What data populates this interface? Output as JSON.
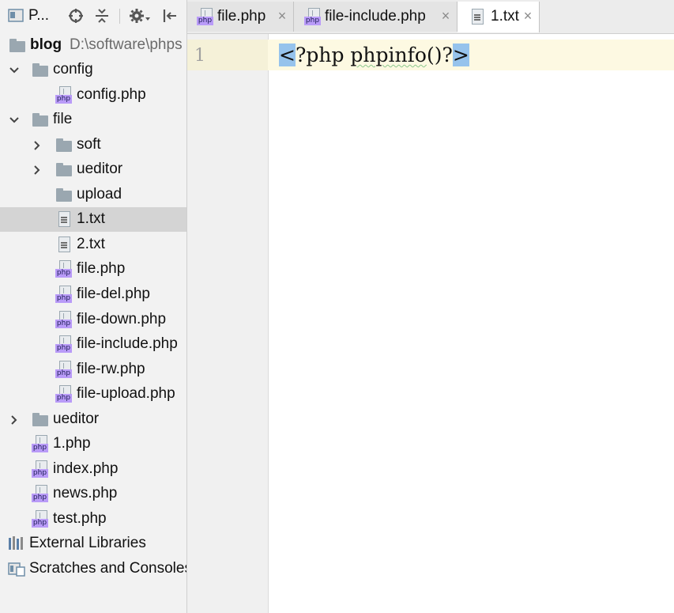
{
  "toolbar": {
    "project_view_label": "P...",
    "icons": [
      "project-view-icon",
      "locate-icon",
      "collapse-all-icon",
      "gear-icon",
      "hide-icon"
    ]
  },
  "tree": {
    "root": {
      "name": "blog",
      "path": "D:\\software\\phps"
    },
    "items": [
      {
        "label": "config",
        "type": "folder"
      },
      {
        "label": "config.php",
        "type": "php"
      },
      {
        "label": "file",
        "type": "folder"
      },
      {
        "label": "soft",
        "type": "folder"
      },
      {
        "label": "ueditor",
        "type": "folder"
      },
      {
        "label": "upload",
        "type": "folder"
      },
      {
        "label": "1.txt",
        "type": "txt"
      },
      {
        "label": "2.txt",
        "type": "txt"
      },
      {
        "label": "file.php",
        "type": "php"
      },
      {
        "label": "file-del.php",
        "type": "php"
      },
      {
        "label": "file-down.php",
        "type": "php"
      },
      {
        "label": "file-include.php",
        "type": "php"
      },
      {
        "label": "file-rw.php",
        "type": "php"
      },
      {
        "label": "file-upload.php",
        "type": "php"
      },
      {
        "label": "ueditor",
        "type": "folder"
      },
      {
        "label": "1.php",
        "type": "php"
      },
      {
        "label": "index.php",
        "type": "php"
      },
      {
        "label": "news.php",
        "type": "php"
      },
      {
        "label": "test.php",
        "type": "php"
      },
      {
        "label": "External Libraries",
        "type": "library"
      },
      {
        "label": "Scratches and Consoles",
        "type": "scratch"
      }
    ],
    "selected": "1.txt",
    "file_badge": "php"
  },
  "tabs": [
    {
      "label": "file.php",
      "close": "×"
    },
    {
      "label": "file-include.php",
      "close": "×"
    },
    {
      "label": "1.txt",
      "close": "×",
      "active": true
    }
  ],
  "editor": {
    "line_number": "1",
    "code": {
      "open_bracket": "<",
      "middle_a": "?php ",
      "squiggly": "phpinfo",
      "middle_b": "()?",
      "close_bracket": ">"
    }
  },
  "colors": {
    "sidebar_bg": "#f2f2f2",
    "selected_row": "#d4d4d4",
    "php_badge": "#b99bf8",
    "bracket_highlight": "#96c3ec",
    "current_line": "#fdf9e2"
  }
}
